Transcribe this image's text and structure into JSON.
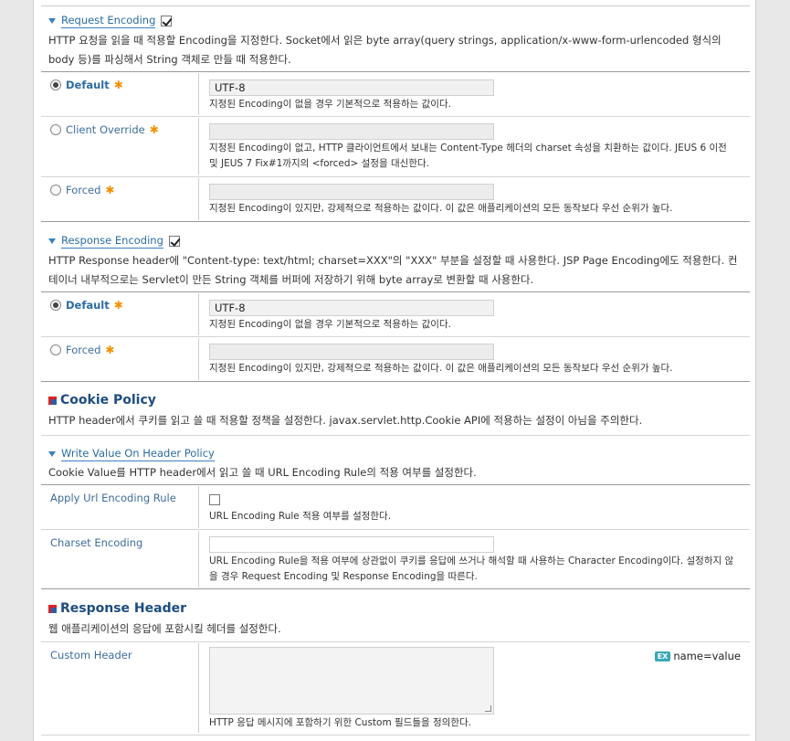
{
  "request_encoding": {
    "title": "Request Encoding",
    "checked": true,
    "description_1": "HTTP 요청을 읽을 때 적용할 Encoding을 지정한다. Socket에서 읽은 byte array(query strings, application/x-www-form-urlencoded 형식의",
    "description_2": "body 등)를 파싱해서 String 객체로 만들 때 적용한다.",
    "default": {
      "label": "Default",
      "value": "UTF-8",
      "help": "지정된 Encoding이 없을 경우 기본적으로 적용하는 값이다."
    },
    "client_override": {
      "label": "Client Override",
      "value": "",
      "help_1": "지정된 Encoding이 없고, HTTP 클라이언트에서 보내는 Content-Type 헤더의 charset 속성을 치환하는 값이다. JEUS 6 이전",
      "help_2": "및 JEUS 7 Fix#1까지의 <forced> 설정을 대신한다."
    },
    "forced": {
      "label": "Forced",
      "value": "",
      "help": "지정된 Encoding이 있지만, 강제적으로 적용하는 값이다. 이 값은 애플리케이션의 모든 동작보다 우선 순위가 높다."
    }
  },
  "response_encoding": {
    "title": "Response Encoding",
    "checked": true,
    "description_1": "HTTP Response header에 \"Content-type: text/html; charset=XXX\"의 \"XXX\" 부분을 설정할 때 사용한다. JSP Page Encoding에도 적용한다. 컨",
    "description_2": "테이너 내부적으로는 Servlet이 만든 String 객체를 버퍼에 저장하기 위해 byte array로 변환할 때 사용한다.",
    "default": {
      "label": "Default",
      "value": "UTF-8",
      "help": "지정된 Encoding이 없을 경우 기본적으로 적용하는 값이다."
    },
    "forced": {
      "label": "Forced",
      "value": "",
      "help": "지정된 Encoding이 있지만, 강제적으로 적용하는 값이다. 이 값은 애플리케이션의 모든 동작보다 우선 순위가 높다."
    }
  },
  "cookie_policy": {
    "title": "Cookie Policy",
    "description": "HTTP header에서 쿠키를 읽고 쓸 때 적용할 정책을 설정한다. javax.servlet.http.Cookie API에 적용하는 설정이 아님을 주의한다."
  },
  "write_value": {
    "title": "Write Value On Header Policy",
    "description": "Cookie Value를 HTTP header에서 읽고 쓸 때 URL Encoding Rule의 적용 여부를 설정한다.",
    "apply_url": {
      "label": "Apply Url Encoding Rule",
      "checked": false,
      "help": "URL Encoding Rule 적용 여부를 설정한다."
    },
    "charset": {
      "label": "Charset Encoding",
      "value": "",
      "help_1": "URL Encoding Rule을 적용 여부에 상관없이 쿠키를 응답에 쓰거나 해석할 때 사용하는 Character Encoding이다. 설정하지 않",
      "help_2": "을 경우 Request Encoding 및 Response Encoding을 따른다."
    }
  },
  "response_header": {
    "title": "Response Header",
    "description": "웹 애플리케이션의 응답에 포함시킬 헤더를 설정한다.",
    "custom": {
      "label": "Custom Header",
      "value": "",
      "example_badge": "EX",
      "example": "name=value",
      "help": "HTTP 응답 메시지에 포함하기 위한 Custom 필드들을 정의한다."
    }
  },
  "colors": {
    "accent": "#2b6ca3",
    "star": "#f29000",
    "badge": "#3aa8b7"
  }
}
